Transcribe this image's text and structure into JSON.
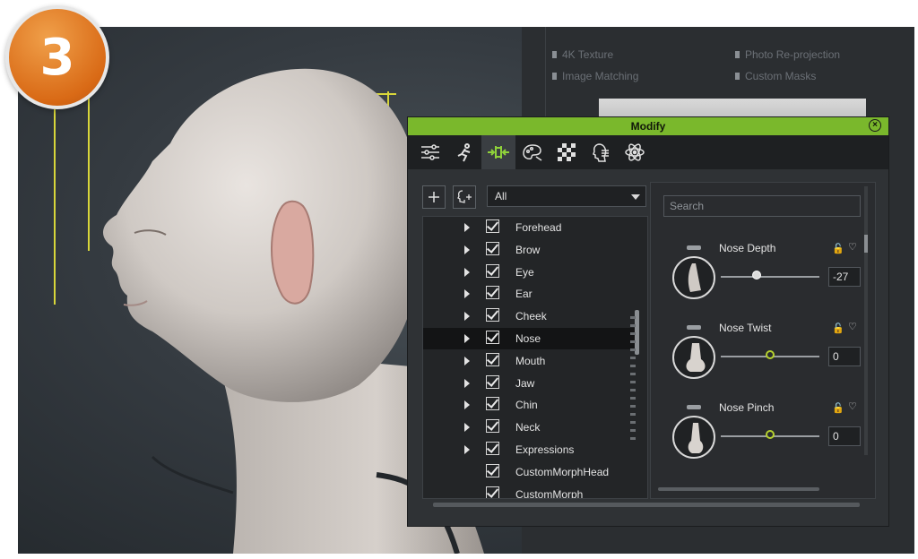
{
  "step_badge": "3",
  "background_panel": {
    "options": [
      "4K Texture",
      "Photo Re-projection",
      "Image Matching",
      "Custom Masks"
    ]
  },
  "modify_panel": {
    "title": "Modify",
    "tabs": [
      "sliders-icon",
      "pose-icon",
      "morph-icon",
      "palette-icon",
      "checker-icon",
      "head-profile-icon",
      "atom-icon"
    ],
    "filter_selected": "All",
    "tree_items": [
      {
        "label": "Forehead",
        "checked": true,
        "expandable": true
      },
      {
        "label": "Brow",
        "checked": true,
        "expandable": true
      },
      {
        "label": "Eye",
        "checked": true,
        "expandable": true
      },
      {
        "label": "Ear",
        "checked": true,
        "expandable": true
      },
      {
        "label": "Cheek",
        "checked": true,
        "expandable": true
      },
      {
        "label": "Nose",
        "checked": true,
        "expandable": true,
        "selected": true
      },
      {
        "label": "Mouth",
        "checked": true,
        "expandable": true
      },
      {
        "label": "Jaw",
        "checked": true,
        "expandable": true
      },
      {
        "label": "Chin",
        "checked": true,
        "expandable": true
      },
      {
        "label": "Neck",
        "checked": true,
        "expandable": true
      },
      {
        "label": "Expressions",
        "checked": true,
        "expandable": true
      },
      {
        "label": "CustomMorphHead",
        "checked": true,
        "expandable": false
      },
      {
        "label": "CustomMorph",
        "checked": true,
        "expandable": false
      }
    ],
    "search_placeholder": "Search",
    "morphs": [
      {
        "name": "Nose Depth",
        "value": "-27",
        "level": 0.36
      },
      {
        "name": "Nose Twist",
        "value": "0",
        "level": 0.5
      },
      {
        "name": "Nose Pinch",
        "value": "0",
        "level": 0.5
      }
    ]
  },
  "colors": {
    "title_bar": "#7ab82c",
    "slider_knob": "#b5d12e",
    "badge": "#e07a1f"
  }
}
